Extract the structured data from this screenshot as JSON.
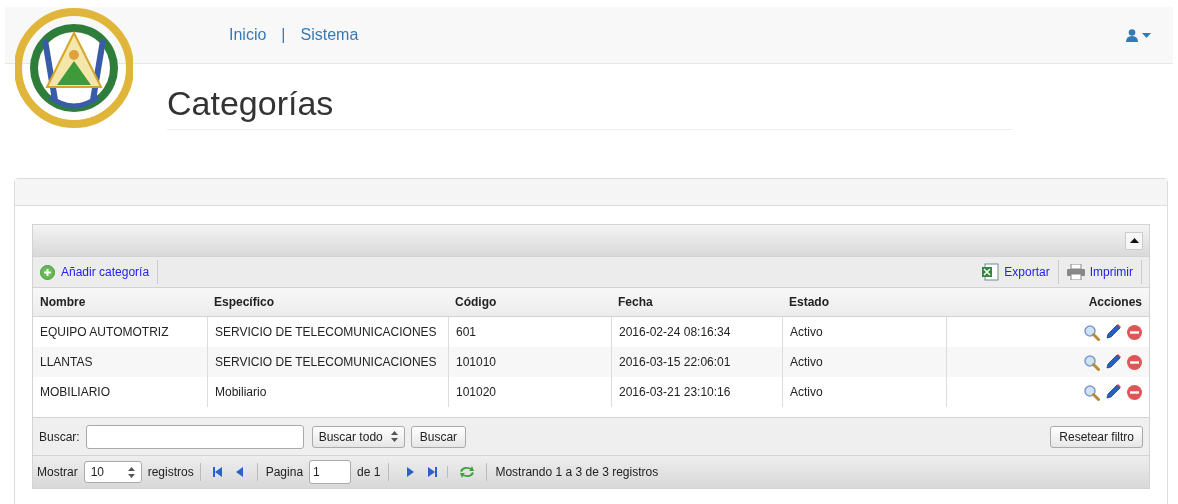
{
  "nav": {
    "links": [
      {
        "label": "Inicio"
      },
      {
        "label": "Sistema"
      }
    ],
    "separator": "|"
  },
  "page_title": "Categorías",
  "grid": {
    "toolbar": {
      "add": "Añadir categoría",
      "export": "Exportar",
      "print": "Imprimir"
    },
    "columns": [
      "Nombre",
      "Específico",
      "Código",
      "Fecha",
      "Estado",
      "Acciones"
    ],
    "rows": [
      {
        "cells": [
          "EQUIPO AUTOMOTRIZ",
          "SERVICIO DE TELECOMUNICACIONES",
          "601",
          "2016-02-24 08:16:34",
          "Activo"
        ]
      },
      {
        "cells": [
          "LLANTAS",
          "SERVICIO DE TELECOMUNICACIONES",
          "101010",
          "2016-03-15 22:06:01",
          "Activo"
        ]
      },
      {
        "cells": [
          "MOBILIARIO",
          "Mobiliario",
          "101020",
          "2016-03-21 23:10:16",
          "Activo"
        ]
      }
    ],
    "search": {
      "label": "Buscar:",
      "scope": "Buscar todo",
      "button": "Buscar",
      "reset": "Resetear filtro"
    },
    "pager": {
      "show_label": "Mostrar",
      "page_size": "10",
      "records_label": "registros",
      "page_label": "Pagina",
      "page": "1",
      "of_label": "de 1",
      "info": "Mostrando 1 a 3 de 3 registros"
    }
  }
}
